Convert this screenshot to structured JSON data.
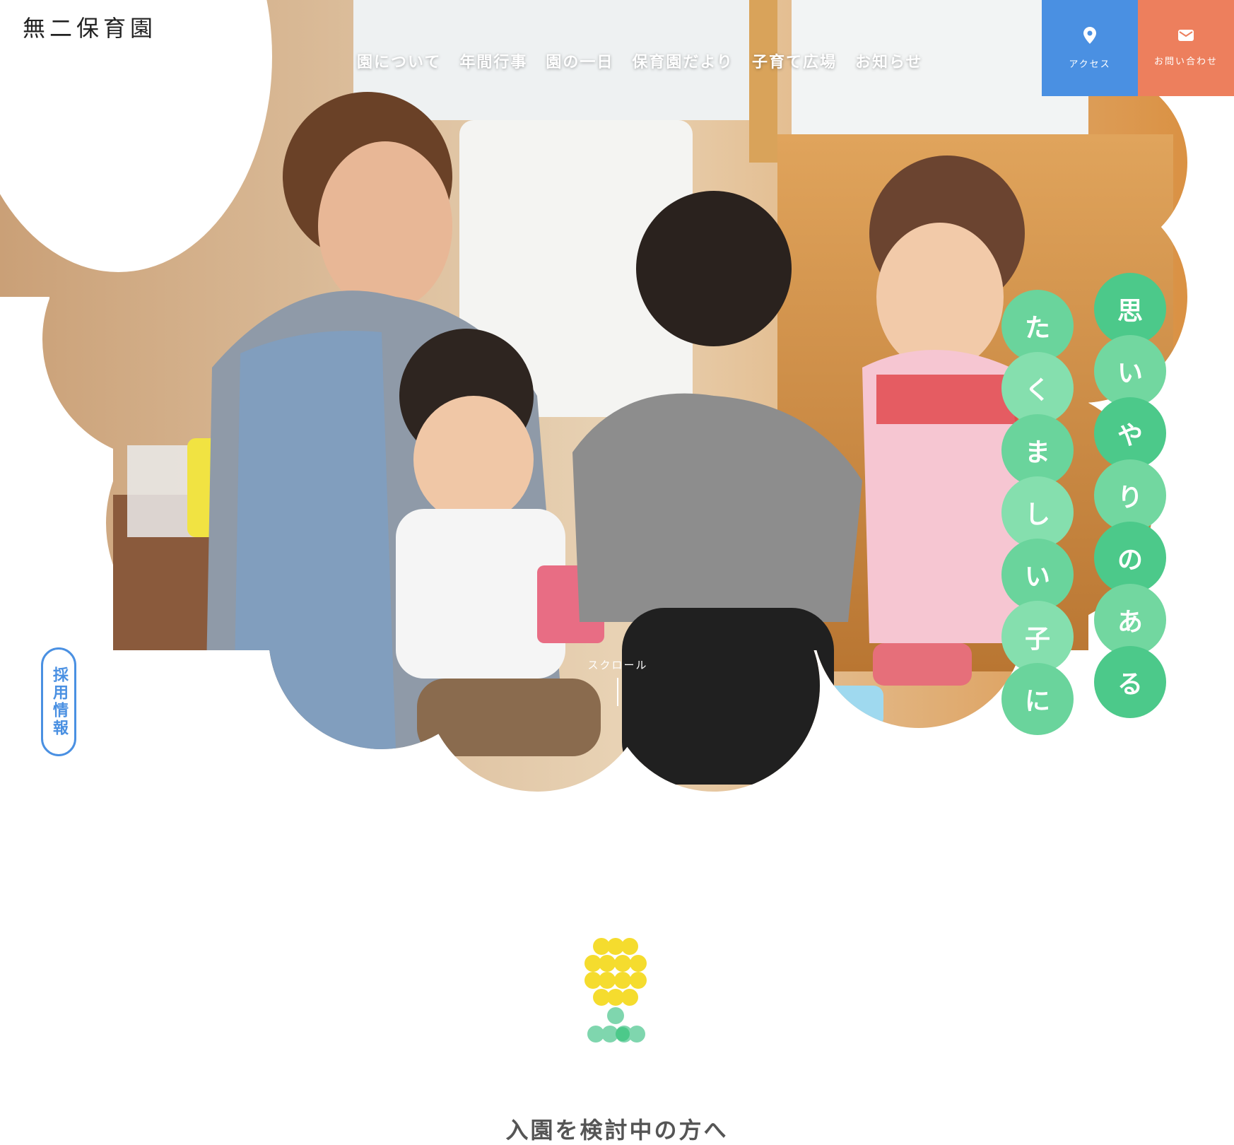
{
  "site": {
    "name": "無二保育園"
  },
  "nav": {
    "items": [
      "園について",
      "年間行事",
      "園の一日",
      "保育園だより",
      "子育て広場",
      "お知らせ"
    ]
  },
  "corner": {
    "access_label": "アクセス",
    "contact_label": "お問い合わせ",
    "access_icon": "map-pin-icon",
    "contact_icon": "mail-icon"
  },
  "recruit": {
    "label": "採用情報"
  },
  "catch_copy": {
    "line1": [
      "思",
      "い",
      "や",
      "り",
      "の",
      "あ",
      "る"
    ],
    "line2": [
      "た",
      "く",
      "ま",
      "し",
      "い",
      "子",
      "に"
    ]
  },
  "scroll": {
    "label": "スクロール"
  },
  "intro": {
    "heading": "入園を検討中の方へ"
  },
  "colors": {
    "accent_blue": "#4a90e2",
    "accent_orange": "#ed7f5d",
    "accent_green": "#4cc98a",
    "flower_yellow": "#f5dc2e"
  }
}
